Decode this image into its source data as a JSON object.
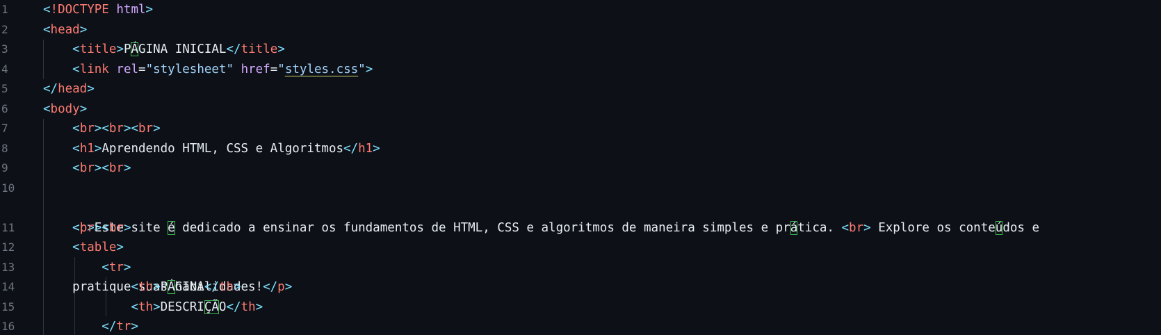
{
  "editor": {
    "line_numbers": [
      "1",
      "2",
      "3",
      "4",
      "5",
      "6",
      "7",
      "8",
      "9",
      "10",
      "11",
      "12",
      "13",
      "14",
      "15",
      "16"
    ],
    "l1": {
      "open": "<",
      "doctype": "!DOCTYPE",
      "name": "html",
      "close": ">"
    },
    "l2": {
      "open": "<",
      "tag": "head",
      "close": ">"
    },
    "l3": {
      "open": "<",
      "tag": "title",
      "close": ">",
      "text_a": "P",
      "text_b": "Á",
      "text_c": "GINA INICIAL",
      "end_open": "</",
      "end_tag": "title",
      "end_close": ">"
    },
    "l4": {
      "open": "<",
      "tag": "link",
      "sp1": " ",
      "attr1": "rel",
      "eq1": "=",
      "q1a": "\"",
      "val1": "stylesheet",
      "q1b": "\"",
      "sp2": " ",
      "attr2": "href",
      "eq2": "=",
      "q2a": "\"",
      "val2": "styles.css",
      "q2b": "\"",
      "close": ">"
    },
    "l5": {
      "open": "</",
      "tag": "head",
      "close": ">"
    },
    "l6": {
      "open": "<",
      "tag": "body",
      "close": ">"
    },
    "l7": {
      "a": "<",
      "b": "br",
      "c": "><",
      "d": "br",
      "e": "><",
      "f": "br",
      "g": ">"
    },
    "l8": {
      "open": "<",
      "tag": "h1",
      "close": ">",
      "text": "Aprendendo HTML, CSS e Algoritmos",
      "end_open": "</",
      "end_tag": "h1",
      "end_close": ">"
    },
    "l9": {
      "a": "<",
      "b": "br",
      "c": "><",
      "d": "br",
      "e": ">"
    },
    "l10": {
      "open": "<",
      "tag": "p",
      "close": ">",
      "t1": "Este site ",
      "t1b": "é",
      "t2": " dedicado a ensinar os fundamentos de HTML, CSS e algoritmos de maneira simples e pr",
      "t2b": "á",
      "t3": "tica. ",
      "br_open": "<",
      "br_tag": "br",
      "br_close": ">",
      "t4": " Explore os conte",
      "t4b": "ú",
      "t5": "dos e",
      "t6": "pratique suas habilidades!",
      "end_open": "</",
      "end_tag": "p",
      "end_close": ">"
    },
    "l11": {
      "a": "<",
      "b": "br",
      "c": "><",
      "d": "br",
      "e": ">"
    },
    "l12": {
      "open": "<",
      "tag": "table",
      "close": ">"
    },
    "l13": {
      "open": "<",
      "tag": "tr",
      "close": ">"
    },
    "l14": {
      "open": "<",
      "tag": "th",
      "close": ">",
      "text_a": "P",
      "text_b": "Á",
      "text_c": "GINA",
      "end_open": "</",
      "end_tag": "th",
      "end_close": ">"
    },
    "l15": {
      "open": "<",
      "tag": "th",
      "close": ">",
      "text_a": "DESCRI",
      "text_b": "ÇÃ",
      "text_c": "O",
      "end_open": "</",
      "end_tag": "th",
      "end_close": ">"
    },
    "l16": {
      "open": "</",
      "tag": "tr",
      "close": ">"
    }
  }
}
